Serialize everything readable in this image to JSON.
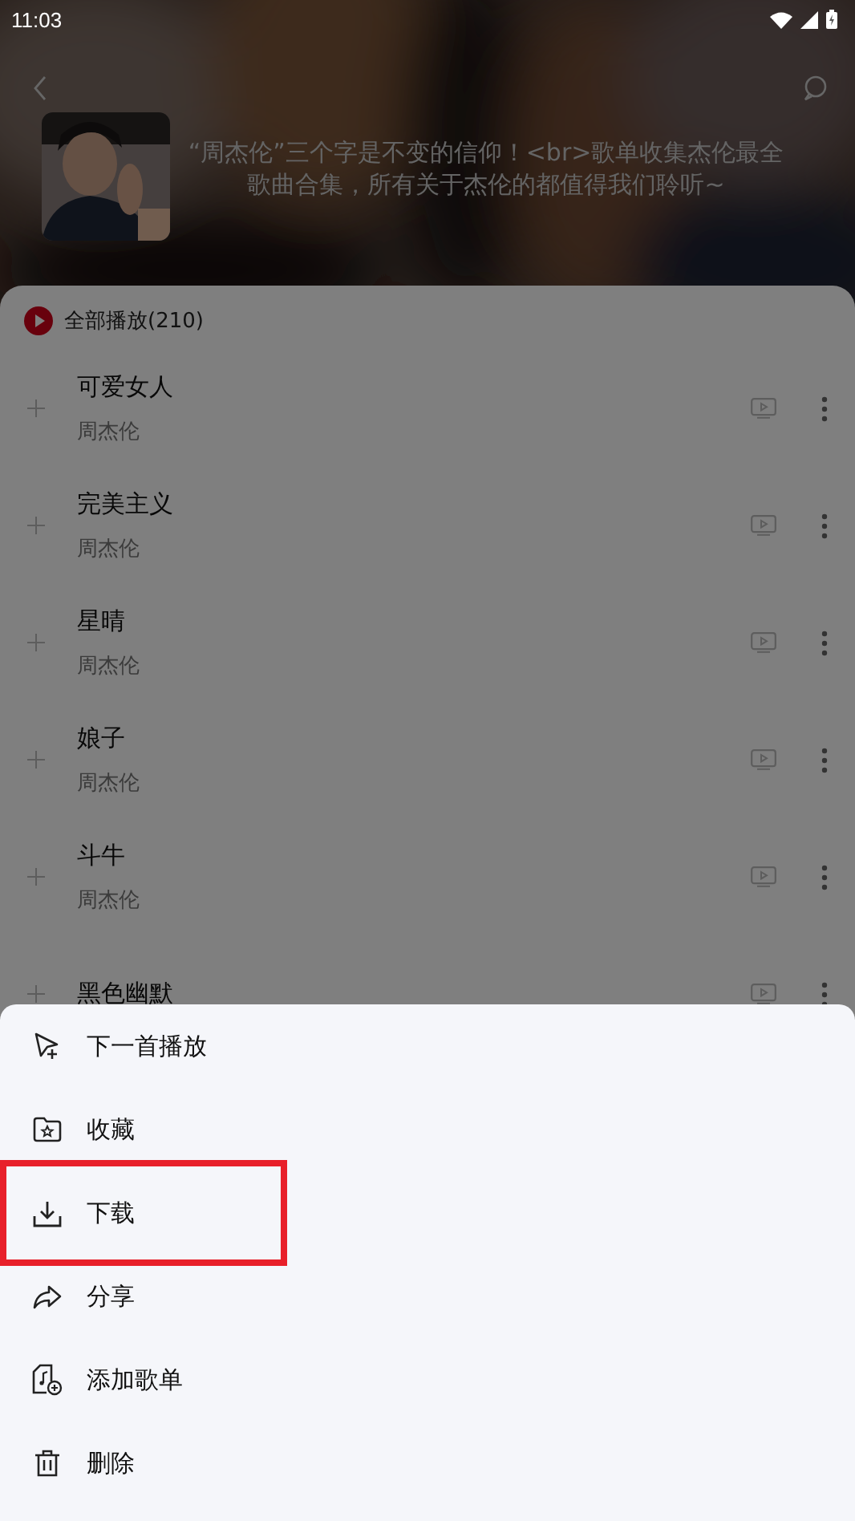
{
  "status_bar": {
    "time": "11:03"
  },
  "header": {
    "description": "“周杰伦”三个字是不变的信仰！<br>歌单收集杰伦最全歌曲合集，所有关于杰伦的都值得我们聆听~"
  },
  "play_all": {
    "label": "全部播放(210)"
  },
  "songs": [
    {
      "title": "可爱女人",
      "artist": "周杰伦"
    },
    {
      "title": "完美主义",
      "artist": "周杰伦"
    },
    {
      "title": "星晴",
      "artist": "周杰伦"
    },
    {
      "title": "娘子",
      "artist": "周杰伦"
    },
    {
      "title": "斗牛",
      "artist": "周杰伦"
    },
    {
      "title": "黑色幽默"
    }
  ],
  "action_sheet": {
    "items": [
      {
        "label": "下一首播放",
        "highlighted": false
      },
      {
        "label": "收藏",
        "highlighted": false
      },
      {
        "label": "下载",
        "highlighted": true
      },
      {
        "label": "分享",
        "highlighted": false
      },
      {
        "label": "添加歌单",
        "highlighted": false
      },
      {
        "label": "删除",
        "highlighted": false
      }
    ]
  }
}
